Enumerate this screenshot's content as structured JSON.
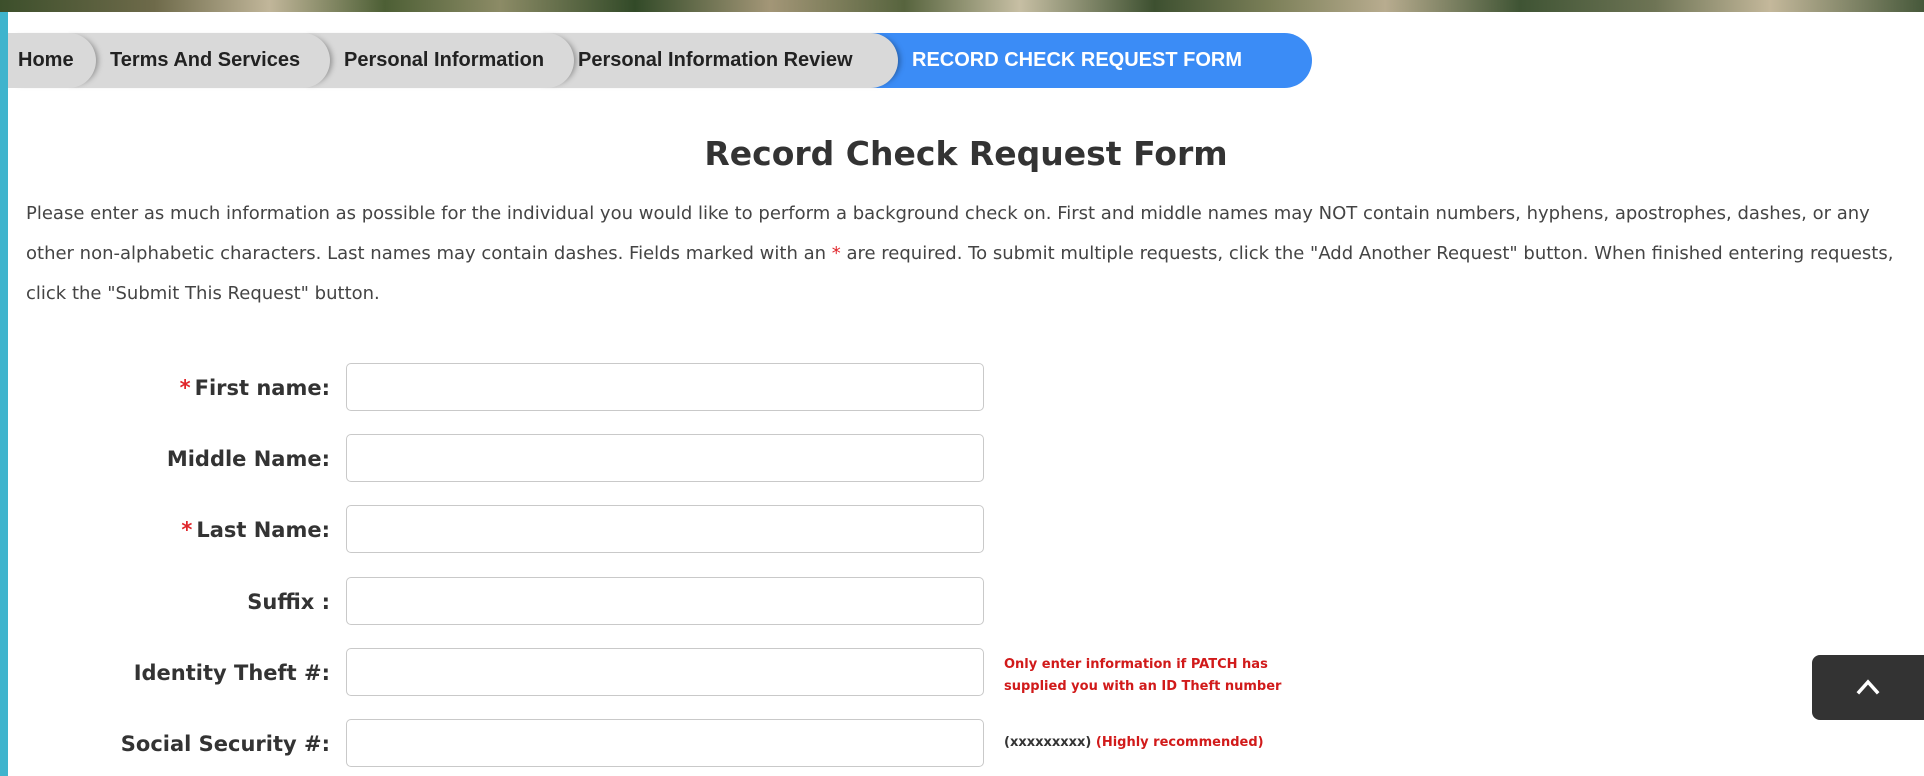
{
  "breadcrumb": {
    "items": [
      {
        "label": "Home"
      },
      {
        "label": "Terms And Services"
      },
      {
        "label": "Personal Information"
      },
      {
        "label": "Personal Information Review"
      },
      {
        "label": "RECORD CHECK REQUEST FORM"
      }
    ],
    "active_color": "#3b8cf6"
  },
  "page": {
    "title": "Record Check Request Form",
    "intro_part1": "Please enter as much information as possible for the individual you would like to perform a background check on. First and middle names may NOT contain numbers, hyphens, apostrophes, dashes, or any other non-alphabetic characters. Last names may contain dashes. Fields marked with an ",
    "intro_star": "*",
    "intro_part2": " are required. To submit multiple requests, click the \"Add Another Request\" button. When finished entering requests, click the \"Submit This Request\" button."
  },
  "form": {
    "required_marker": "*",
    "fields": [
      {
        "label": "First name:",
        "required": true,
        "value": ""
      },
      {
        "label": "Middle Name:",
        "required": false,
        "value": ""
      },
      {
        "label": "Last Name:",
        "required": true,
        "value": ""
      },
      {
        "label": "Suffix :",
        "required": false,
        "value": ""
      },
      {
        "label": "Identity Theft #:",
        "required": false,
        "value": ""
      },
      {
        "label": "Social Security #:",
        "required": false,
        "value": ""
      }
    ],
    "id_theft_note_line1": "Only enter information if PATCH has",
    "id_theft_note_line2": "supplied you with an ID Theft number",
    "ssn_format": "(xxxxxxxxx)",
    "ssn_note": "(Highly recommended)"
  },
  "scroll_top": {
    "icon": "chevron-up-icon"
  },
  "colors": {
    "required": "#e0262b",
    "note": "#d11a1a",
    "sidebar": "#3fb4cd"
  }
}
